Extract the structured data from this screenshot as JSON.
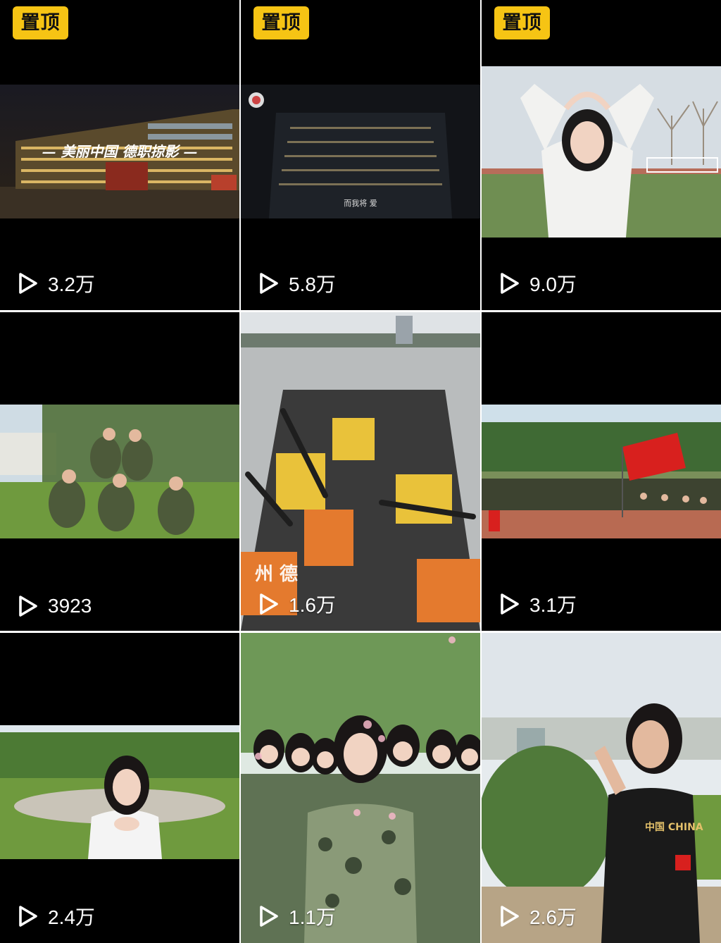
{
  "pin_label": "置顶",
  "videos": [
    {
      "pinned": true,
      "play_count": "3.2万",
      "caption_art": "— 美丽中国 德职掠影 —"
    },
    {
      "pinned": true,
      "play_count": "5.8万",
      "caption_art": "而我将 爱"
    },
    {
      "pinned": true,
      "play_count": "9.0万"
    },
    {
      "pinned": false,
      "play_count": "3923"
    },
    {
      "pinned": false,
      "play_count": "1.6万",
      "caption_art": "州 德"
    },
    {
      "pinned": false,
      "play_count": "3.1万"
    },
    {
      "pinned": false,
      "play_count": "2.4万"
    },
    {
      "pinned": false,
      "play_count": "1.1万"
    },
    {
      "pinned": false,
      "play_count": "2.6万",
      "caption_art": "中国 CHINA"
    }
  ],
  "icons": {
    "play": "play-triangle-icon"
  },
  "colors": {
    "pin_badge": "#f6c414",
    "background": "#000000",
    "divider": "#ffffff"
  }
}
